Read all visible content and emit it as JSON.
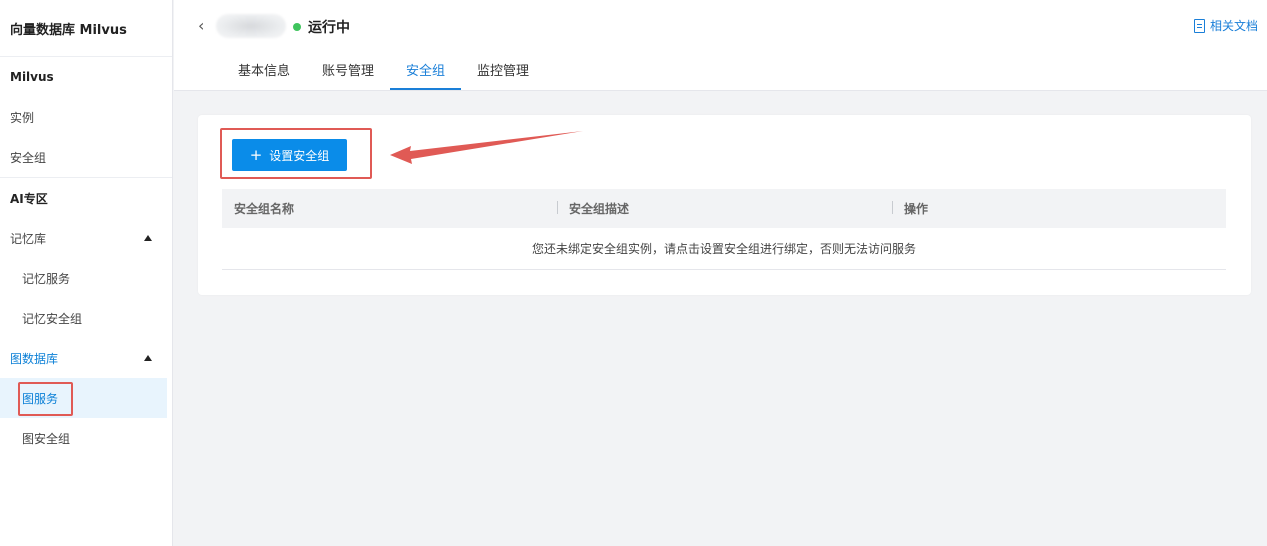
{
  "app_title": "向量数据库 Milvus",
  "sidebar": {
    "sections": [
      {
        "label": "Milvus"
      },
      {
        "label": "AI专区"
      }
    ],
    "items": {
      "instance": "实例",
      "security_group": "安全组",
      "memory_db": "记忆库",
      "memory_service": "记忆服务",
      "memory_security_group": "记忆安全组",
      "graph_db": "图数据库",
      "graph_service": "图服务",
      "graph_security_group": "图安全组"
    }
  },
  "header": {
    "status": "运行中",
    "status_color": "#3fc45d",
    "doc_link": "相关文档",
    "tabs": [
      {
        "label": "基本信息"
      },
      {
        "label": "账号管理"
      },
      {
        "label": "安全组",
        "active": true
      },
      {
        "label": "监控管理"
      }
    ]
  },
  "content": {
    "set_security_group_button": "设置安全组",
    "table_headers": [
      "安全组名称",
      "安全组描述",
      "操作"
    ],
    "empty_message": "您还未绑定安全组实例，请点击设置安全组进行绑定，否则无法访问服务"
  },
  "accent_color": "#0a8ce9",
  "annotation_color": "#e05a55"
}
